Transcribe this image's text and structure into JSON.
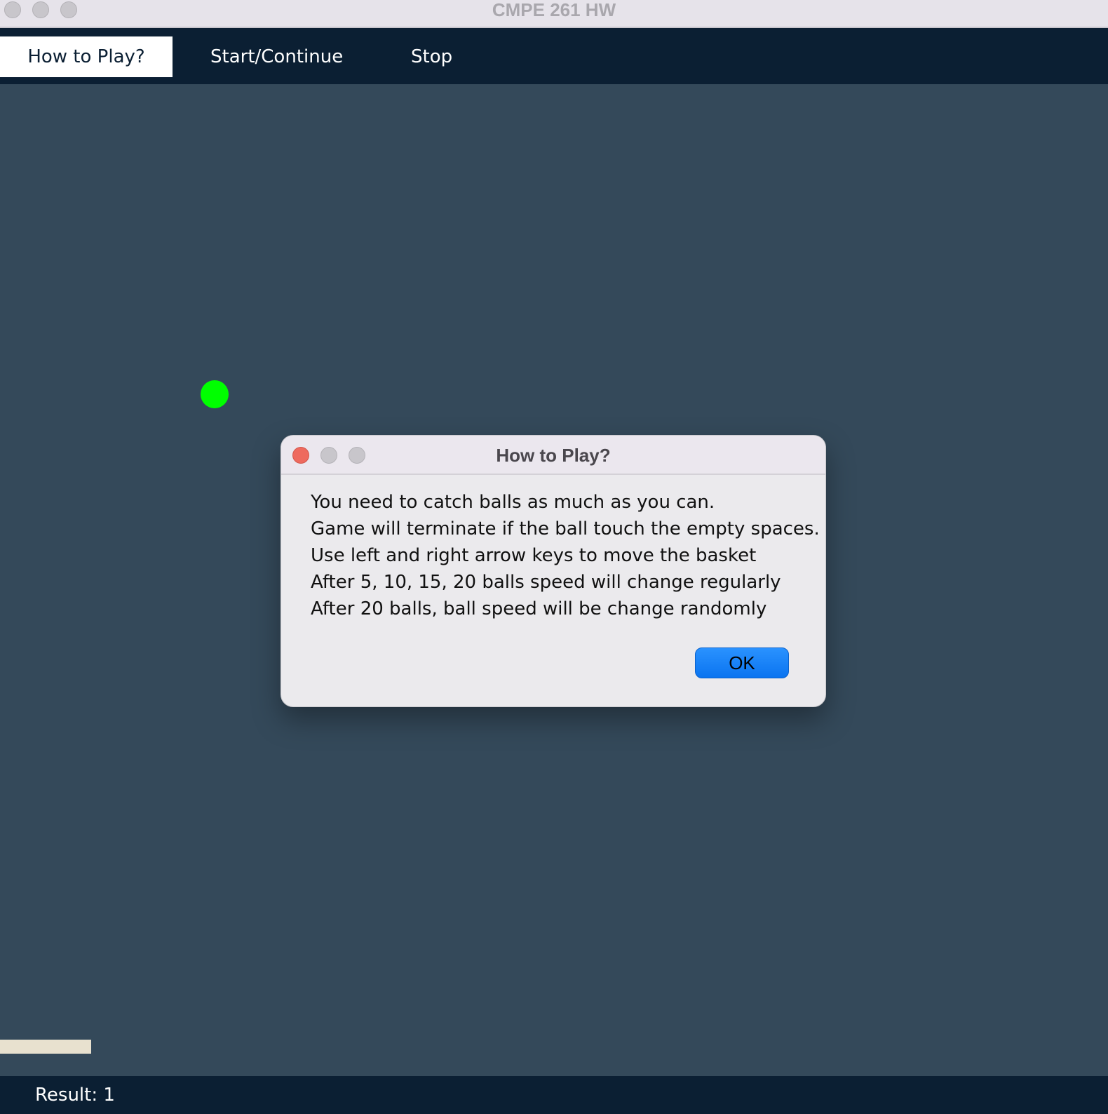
{
  "window": {
    "title": "CMPE 261 HW"
  },
  "menu": {
    "items": [
      {
        "label": "How to Play?",
        "active": true
      },
      {
        "label": "Start/Continue",
        "active": false
      },
      {
        "label": "Stop",
        "active": false
      }
    ]
  },
  "game": {
    "ball_color": "#00ff00",
    "basket_color": "#e8e1cf",
    "background_color": "#34495a"
  },
  "status": {
    "result_label": "Result:",
    "result_value": "1"
  },
  "dialog": {
    "title": "How to Play?",
    "lines": [
      "You need to catch balls as much as you can.",
      "Game will terminate if the ball touch the empty spaces.",
      "Use left and right arrow keys to move the basket",
      "After 5, 10, 15, 20 balls speed will change regularly",
      "After 20 balls, ball speed will be change randomly"
    ],
    "ok_label": "OK"
  }
}
